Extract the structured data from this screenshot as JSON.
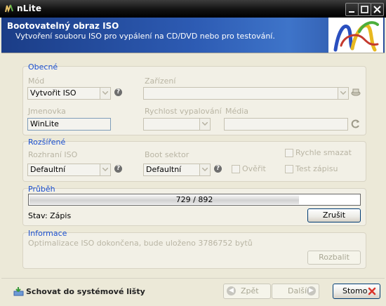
{
  "window": {
    "title": "nLite"
  },
  "header": {
    "title": "Bootovatelný obraz ISO",
    "subtitle": "Vytvoření souboru ISO pro vypálení na CD/DVD nebo pro testování."
  },
  "general": {
    "title": "Obecné",
    "mode_label": "Mód",
    "mode_value": "Vytvořit ISO",
    "device_label": "Zařízení",
    "device_value": "",
    "label_label": "Jmenovka",
    "label_value": "WinLite",
    "speed_label": "Rychlost vypalování",
    "speed_value": "",
    "media_label": "Média",
    "media_value": ""
  },
  "advanced": {
    "title": "Rozšířené",
    "interface_label": "Rozhraní ISO",
    "interface_value": "Defaultní",
    "boot_label": "Boot sektor",
    "boot_value": "Defaultní",
    "verify_label": "Ověřit",
    "quick_erase_label": "Rychle smazat",
    "test_write_label": "Test zápisu"
  },
  "progress": {
    "title": "Průběh",
    "text": "729 / 892",
    "fraction": 0.817,
    "status": "Stav: Zápis",
    "cancel_label": "Zrušit"
  },
  "info": {
    "title": "Informace",
    "message": "Optimalizace ISO dokončena, bude uloženo 3786752 bytů",
    "expand_label": "Rozbalit"
  },
  "footer": {
    "tray_label": "Schovat do systémové lišty",
    "back_label": "Zpět",
    "next_label": "Další",
    "stop_label": "Stomo"
  },
  "colors": {
    "accent": "#1a4fd0",
    "header": "#2d5bb3",
    "stop_icon": "#d9342b"
  }
}
